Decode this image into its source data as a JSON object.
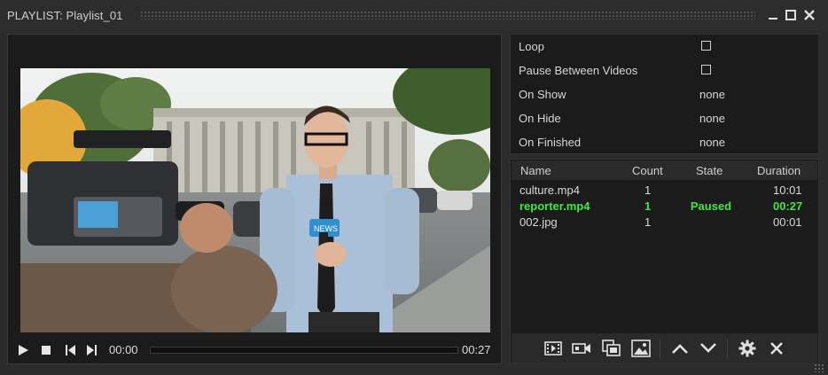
{
  "window": {
    "title": "PLAYLIST: Playlist_01"
  },
  "player": {
    "current_time": "00:00",
    "total_time": "00:27",
    "progress": 0
  },
  "settings": {
    "loop": {
      "label": "Loop",
      "checked": false
    },
    "pause_between": {
      "label": "Pause Between Videos",
      "checked": false
    },
    "on_show": {
      "label": "On Show",
      "value": "none"
    },
    "on_hide": {
      "label": "On Hide",
      "value": "none"
    },
    "on_finished": {
      "label": "On Finished",
      "value": "none"
    }
  },
  "playlist": {
    "columns": {
      "name": "Name",
      "count": "Count",
      "state": "State",
      "duration": "Duration"
    },
    "rows": [
      {
        "name": "culture.mp4",
        "count": "1",
        "state": "",
        "duration": "10:01",
        "active": false
      },
      {
        "name": "reporter.mp4",
        "count": "1",
        "state": "Paused",
        "duration": "00:27",
        "active": true
      },
      {
        "name": "002.jpg",
        "count": "1",
        "state": "",
        "duration": "00:01",
        "active": false
      }
    ]
  },
  "colors": {
    "active_row": "#3fe83f",
    "background": "#2b2b2b",
    "panel": "#1b1b1b"
  },
  "icons": {
    "window": [
      "minimize-icon",
      "maximize-icon",
      "close-icon"
    ],
    "transport": [
      "play-icon",
      "stop-icon",
      "previous-icon",
      "next-icon"
    ],
    "toolbar": [
      "add-video-icon",
      "add-camera-icon",
      "add-copy-icon",
      "add-image-icon",
      "move-up-icon",
      "move-down-icon",
      "gear-icon",
      "remove-icon"
    ]
  }
}
